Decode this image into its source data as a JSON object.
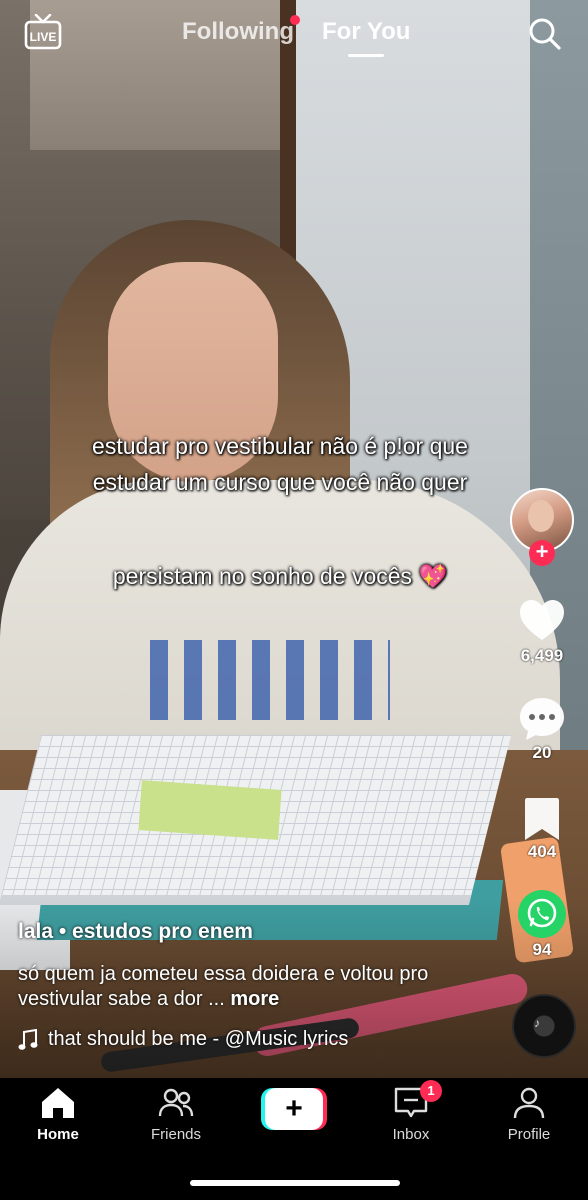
{
  "topbar": {
    "live_label": "LIVE",
    "tab_following": "Following",
    "tab_for_you": "For You",
    "following_has_new": true
  },
  "overlay": {
    "line1": "estudar pro vestibular não é p!or que estudar um curso que você não quer",
    "line2": "persistam no sonho de vocês 💖"
  },
  "actions": {
    "likes": "6,499",
    "comments": "20",
    "saves": "404",
    "shares": "94"
  },
  "post": {
    "username": "lala • estudos pro enem",
    "description": "só quem ja cometeu essa doidera e voltou pro vestivular sabe a dor ...",
    "more_label": "more",
    "sound": "that should be me - @Music lyrics"
  },
  "nav": {
    "home": "Home",
    "friends": "Friends",
    "inbox": "Inbox",
    "profile": "Profile",
    "inbox_badge": "1",
    "create_label": "+"
  },
  "colors": {
    "accent": "#fe2c55",
    "cyan": "#25f4ee",
    "whatsapp": "#25d366"
  }
}
